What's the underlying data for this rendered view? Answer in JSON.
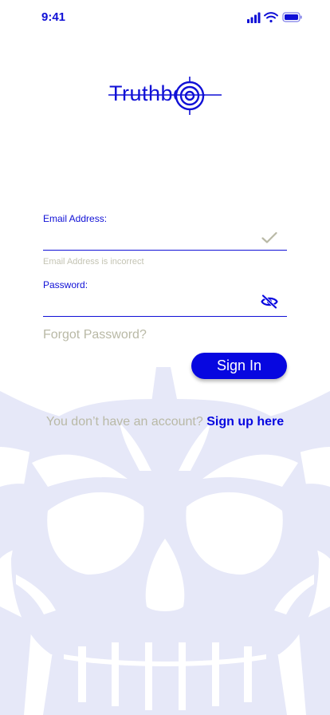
{
  "status_bar": {
    "time": "9:41"
  },
  "logo": {
    "text": "Truthbot"
  },
  "form": {
    "email": {
      "label": "Email Address:",
      "value": "",
      "error": "Email Address  is incorrect"
    },
    "password": {
      "label": "Password:",
      "value": ""
    },
    "forgot_label": "Forgot Password?",
    "sign_in_label": "Sign In"
  },
  "signup": {
    "prompt": "You don’t have an account?",
    "link_label": "Sign up here"
  },
  "colors": {
    "accent": "#0707e0",
    "muted_text": "#b9b9a6",
    "skull_tint": "#e6e8f8"
  },
  "icons": {
    "email_status": "checkmark-icon",
    "password_toggle": "eye-slash-icon",
    "status_signal": "cellular-signal-icon",
    "status_wifi": "wifi-icon",
    "status_battery": "battery-icon",
    "background": "skull-illustration"
  }
}
